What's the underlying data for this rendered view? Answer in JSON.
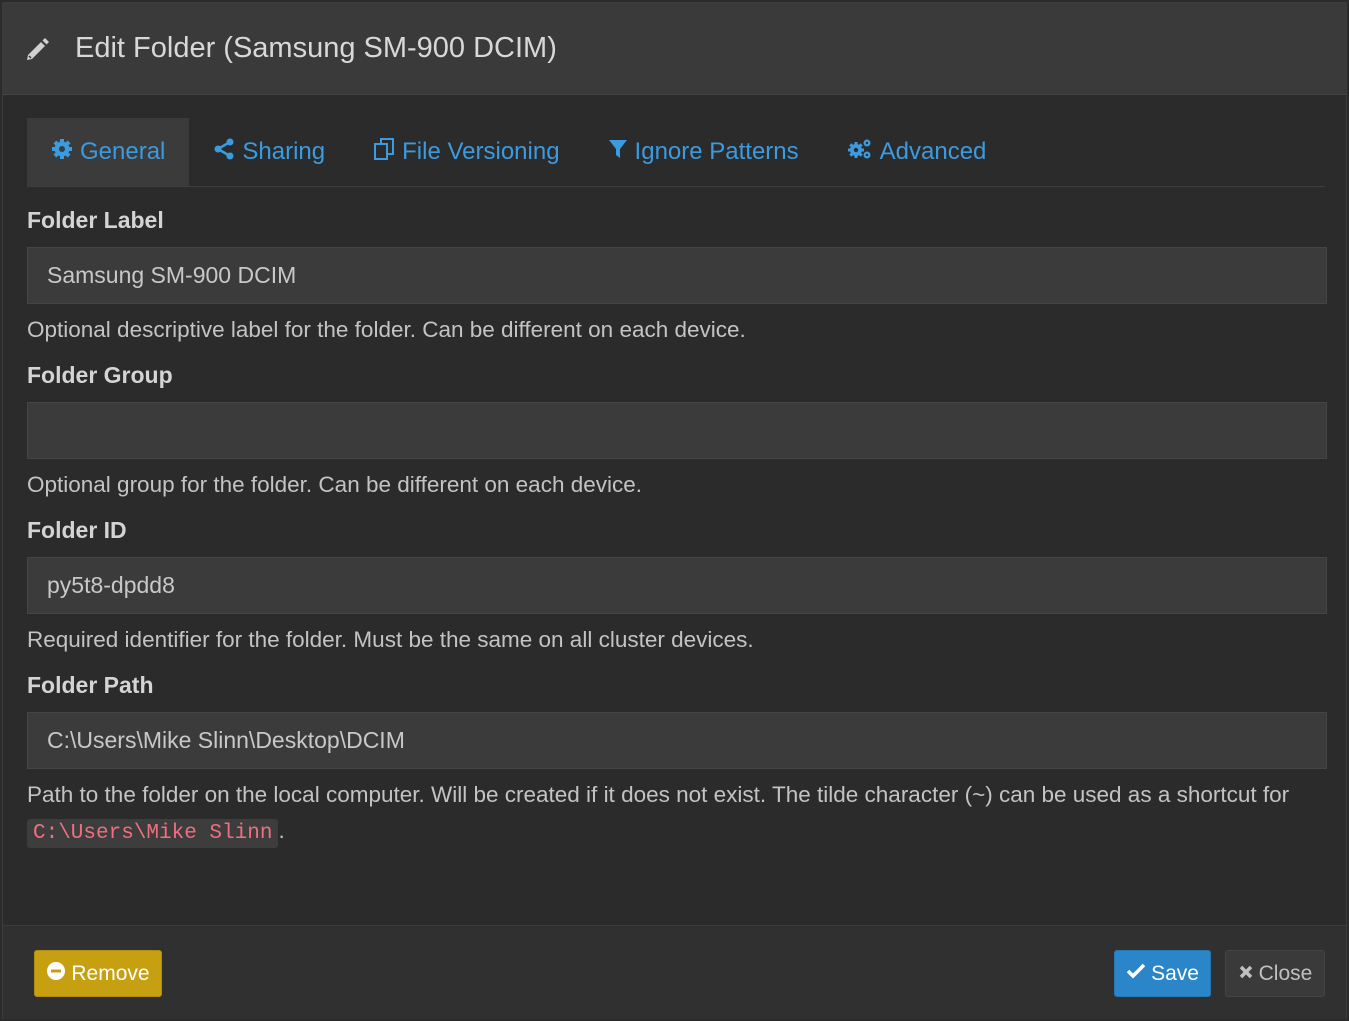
{
  "modal": {
    "title": "Edit Folder (Samsung SM-900 DCIM)",
    "title_icon": "pencil-icon"
  },
  "tabs": [
    {
      "label": "General",
      "icon": "gear-icon",
      "active": true
    },
    {
      "label": "Sharing",
      "icon": "share-icon",
      "active": false
    },
    {
      "label": "File Versioning",
      "icon": "copy-icon",
      "active": false
    },
    {
      "label": "Ignore Patterns",
      "icon": "filter-icon",
      "active": false
    },
    {
      "label": "Advanced",
      "icon": "gears-icon",
      "active": false
    }
  ],
  "fields": {
    "label": {
      "title": "Folder Label",
      "value": "Samsung SM-900 DCIM",
      "help": "Optional descriptive label for the folder. Can be different on each device."
    },
    "group": {
      "title": "Folder Group",
      "value": "",
      "help": "Optional group for the folder. Can be different on each device."
    },
    "id": {
      "title": "Folder ID",
      "value": "py5t8-dpdd8",
      "help": "Required identifier for the folder. Must be the same on all cluster devices."
    },
    "path": {
      "title": "Folder Path",
      "value": "C:\\Users\\Mike Slinn\\Desktop\\DCIM",
      "help_prefix": "Path to the folder on the local computer. Will be created if it does not exist. The tilde character (~) can be used as a shortcut for",
      "help_code": "C:\\Users\\Mike Slinn",
      "help_suffix": "."
    }
  },
  "footer": {
    "remove_label": "Remove",
    "save_label": "Save",
    "close_label": "Close"
  },
  "colors": {
    "accent": "#3b9be0",
    "remove": "#c7a012",
    "save": "#2a86c9",
    "code": "#f06f7f"
  }
}
